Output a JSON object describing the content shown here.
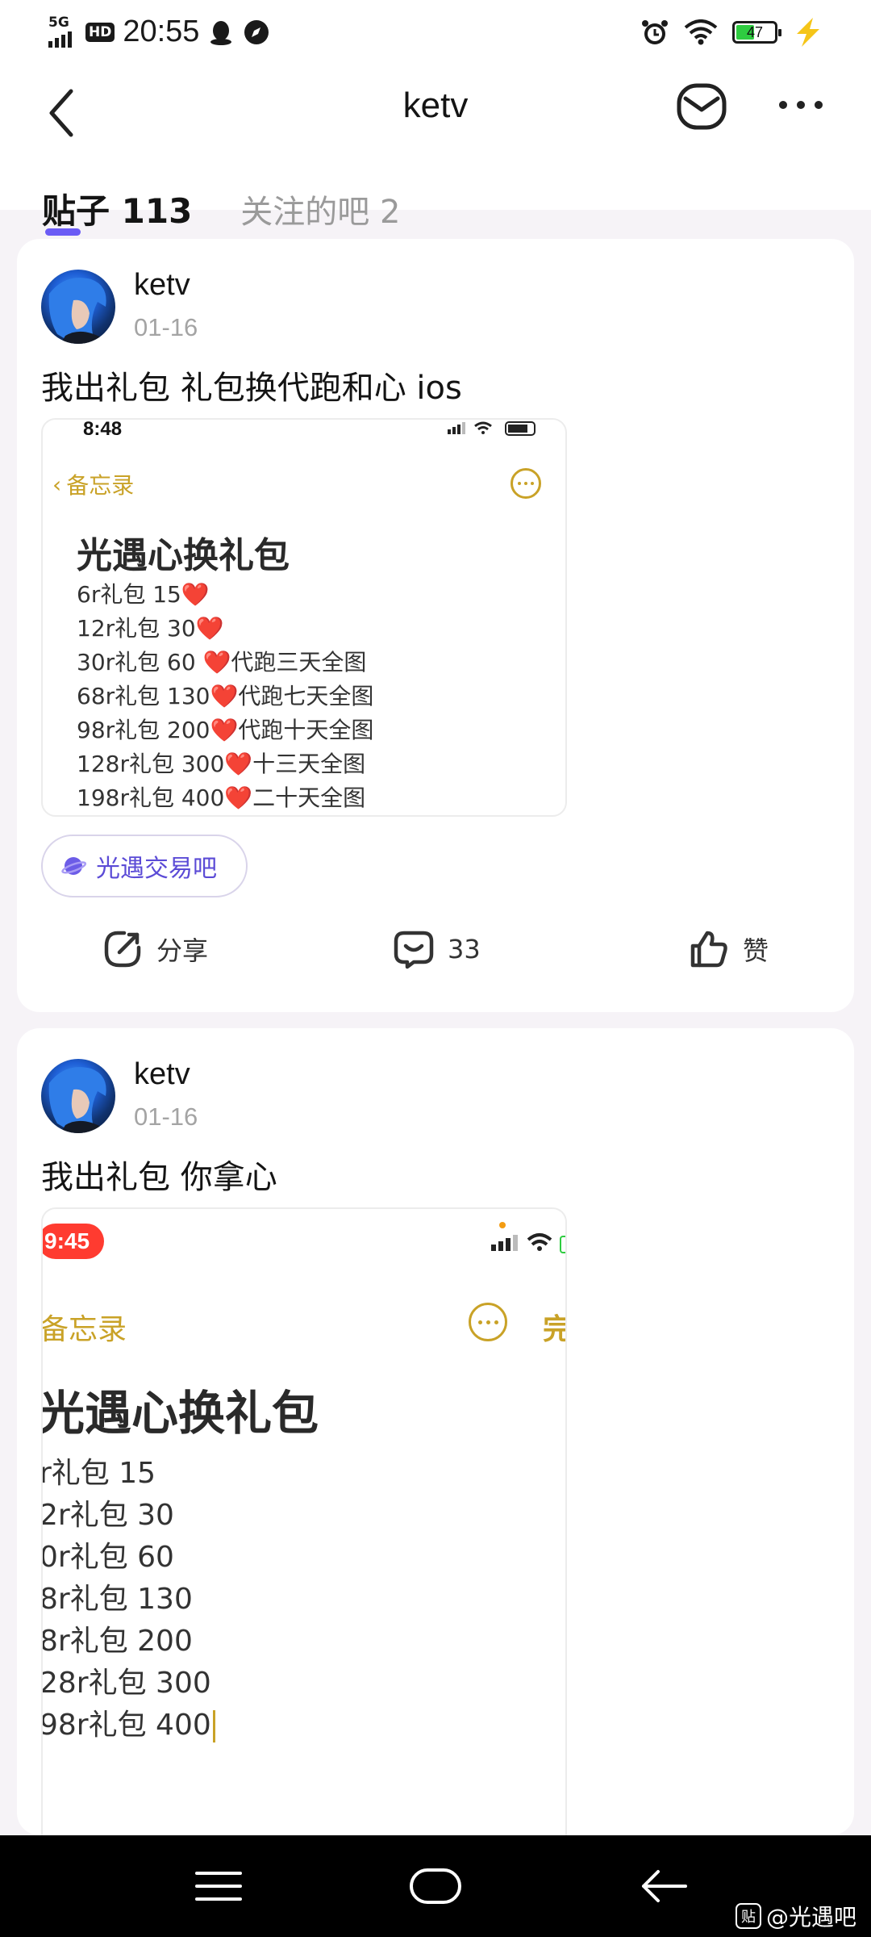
{
  "status_bar": {
    "network": "5G",
    "hd": "HD",
    "time": "20:55",
    "battery": "47",
    "battery_level_percent": 47,
    "icons": [
      "signal-icon",
      "qq-icon",
      "compass-icon",
      "alarm-icon",
      "wifi-icon",
      "battery-icon",
      "charging-icon"
    ]
  },
  "header": {
    "title": "ketv",
    "tabs": [
      {
        "label": "贴子 113",
        "active": true
      },
      {
        "label": "关注的吧 2",
        "active": false
      }
    ],
    "icons": [
      "back-icon",
      "mail-icon",
      "more-icon"
    ],
    "accent_color": "#6b5bf5"
  },
  "posts": [
    {
      "author": "ketv",
      "date": "01-16",
      "text": "我出礼包 礼包换代跑和心 ios",
      "screenshot": {
        "time": "8:48",
        "back": "备忘录",
        "title": "光遇心换礼包",
        "lines": [
          "6r礼包 15❤️",
          "12r礼包 30❤️",
          "30r礼包 60 ❤️代跑三天全图",
          "68r礼包 130❤️代跑七天全图",
          "98r礼包 200❤️代跑十天全图",
          "128r礼包 300❤️十三天全图",
          "198r礼包 400❤️二十天全图"
        ]
      },
      "tag": "光遇交易吧",
      "share_label": "分享",
      "comment_count": "33",
      "like_label": "赞"
    },
    {
      "author": "ketv",
      "date": "01-16",
      "text": "我出礼包 你拿心",
      "screenshot": {
        "time": "9:45",
        "back": "备忘录",
        "done": "完",
        "title": "光遇心换礼包",
        "lines": [
          "r礼包 15",
          "2r礼包 30",
          "0r礼包 60",
          "8r礼包 130",
          "8r礼包 200",
          "28r礼包 300",
          "98r礼包 400"
        ]
      }
    }
  ],
  "nav_bar": {
    "icons": [
      "menu-icon",
      "home-icon",
      "back-arrow-icon"
    ],
    "watermark": "@光遇吧",
    "watermark_icon_char": "贴"
  }
}
